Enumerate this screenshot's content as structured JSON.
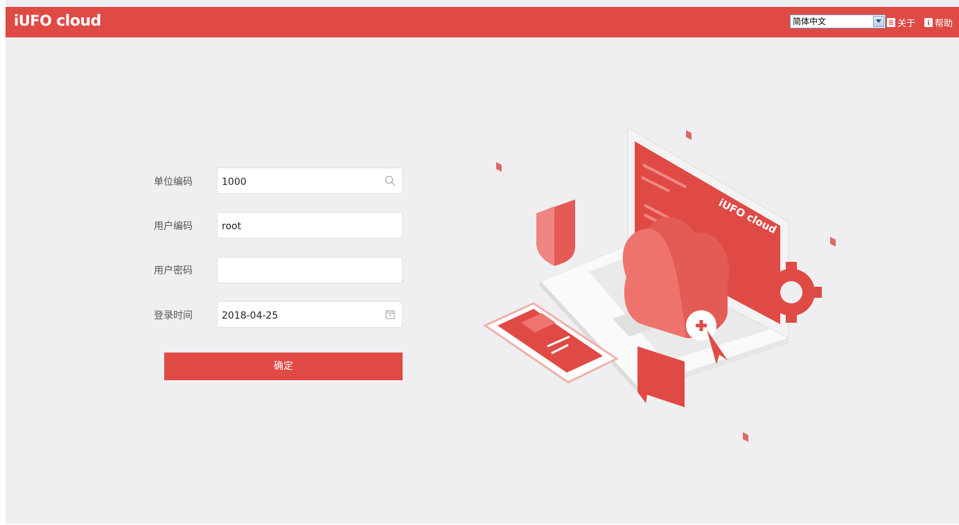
{
  "header": {
    "logo_text_a": "iUFO",
    "logo_text_b": "cloud",
    "language": "简体中文",
    "about_label": "关于",
    "help_label": "帮助"
  },
  "form": {
    "unit_code_label": "单位编码",
    "unit_code_value": "1000",
    "user_code_label": "用户编码",
    "user_code_value": "root",
    "password_label": "用户密码",
    "password_value": "",
    "login_time_label": "登录时间",
    "login_time_value": "2018-04-25",
    "submit_label": "确定"
  },
  "illustration": {
    "screen_brand": "iUFO cloud"
  },
  "colors": {
    "brand_red": "#e04a45",
    "page_bg": "#efeff1"
  },
  "icons": [
    "search-icon",
    "calendar-icon",
    "about-icon",
    "help-icon",
    "dropdown-arrow-icon"
  ]
}
